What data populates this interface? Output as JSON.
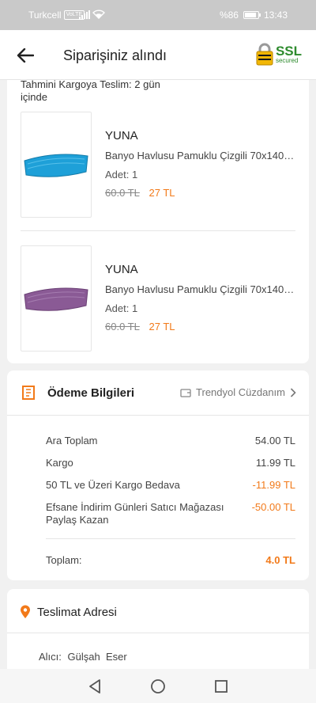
{
  "status_bar": {
    "carrier": "Turkcell",
    "volte": "VoLTE",
    "battery": "%86",
    "battery_level": 0.86,
    "time": "13:43"
  },
  "header": {
    "title": "Siparişiniz alındı",
    "ssl_label": "SSL",
    "ssl_sub": "secured"
  },
  "products": {
    "delivery_note": "Tahmini Kargoya Teslim: 2 gün içinde",
    "items": [
      {
        "brand": "YUNA",
        "name": "Banyo Havlusu Pamuklu Çizgili 70x140 cm",
        "qty": "Adet: 1",
        "old_price": "60.0 TL",
        "price": "27 TL",
        "color": "#1ea0d8"
      },
      {
        "brand": "YUNA",
        "name": "Banyo Havlusu Pamuklu Çizgili 70x140 cm",
        "qty": "Adet: 1",
        "old_price": "60.0 TL",
        "price": "27 TL",
        "color": "#8a5a95"
      }
    ]
  },
  "payment": {
    "title": "Ödeme Bilgileri",
    "wallet": "Trendyol Cüzdanım",
    "rows": [
      {
        "label": "Ara Toplam",
        "value": "54.00 TL"
      },
      {
        "label": "Kargo",
        "value": "11.99 TL"
      },
      {
        "label": "50 TL ve Üzeri Kargo Bedava",
        "value": "-11.99 TL"
      },
      {
        "label": "Efsane İndirim Günleri Satıcı Mağazası Paylaş Kazan",
        "value": "-50.00 TL"
      }
    ],
    "total_label": "Toplam:",
    "total_value": "4.0 TL"
  },
  "address": {
    "title": "Teslimat Adresi",
    "recipient_label": "Alıcı:",
    "recipient_name": "Gülşah  Eser"
  },
  "colors": {
    "accent": "#f27a1a",
    "ssl_green": "#2e8b2e"
  }
}
